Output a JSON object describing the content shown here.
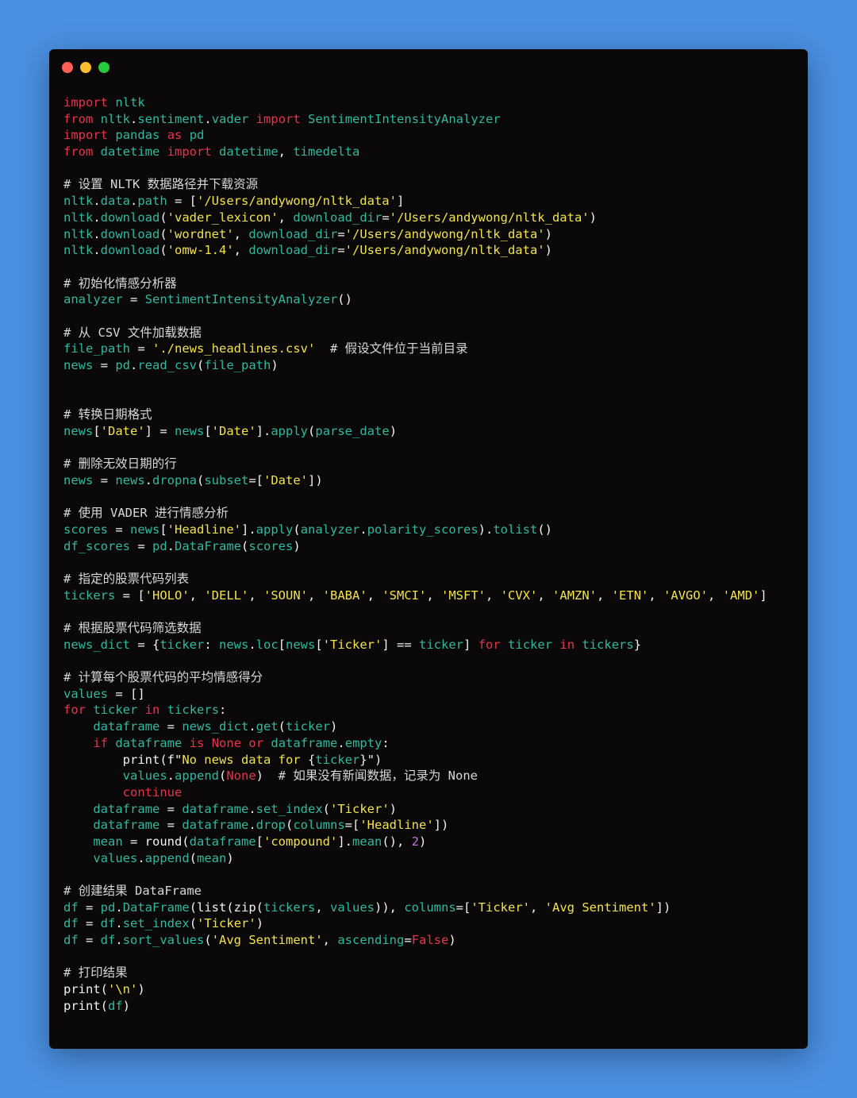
{
  "window": {
    "buttons": [
      "close",
      "minimize",
      "maximize"
    ]
  },
  "colors": {
    "background": "#4a90e2",
    "editor_bg": "#0a0808",
    "keyword": "#e8344a",
    "identifier": "#2fb99f",
    "string": "#f2e34c",
    "comment": "#d8d8d8",
    "number": "#c678dd",
    "plain": "#f2f2f2"
  },
  "code_lines": [
    [
      [
        "kw",
        "import"
      ],
      [
        "pl",
        " "
      ],
      [
        "id",
        "nltk"
      ]
    ],
    [
      [
        "kw",
        "from"
      ],
      [
        "pl",
        " "
      ],
      [
        "id",
        "nltk"
      ],
      [
        "pl",
        "."
      ],
      [
        "id",
        "sentiment"
      ],
      [
        "pl",
        "."
      ],
      [
        "id",
        "vader"
      ],
      [
        "pl",
        " "
      ],
      [
        "kw",
        "import"
      ],
      [
        "pl",
        " "
      ],
      [
        "id",
        "SentimentIntensityAnalyzer"
      ]
    ],
    [
      [
        "kw",
        "import"
      ],
      [
        "pl",
        " "
      ],
      [
        "id",
        "pandas"
      ],
      [
        "pl",
        " "
      ],
      [
        "kw",
        "as"
      ],
      [
        "pl",
        " "
      ],
      [
        "id",
        "pd"
      ]
    ],
    [
      [
        "kw",
        "from"
      ],
      [
        "pl",
        " "
      ],
      [
        "id",
        "datetime"
      ],
      [
        "pl",
        " "
      ],
      [
        "kw",
        "import"
      ],
      [
        "pl",
        " "
      ],
      [
        "id",
        "datetime"
      ],
      [
        "pl",
        ", "
      ],
      [
        "id",
        "timedelta"
      ]
    ],
    [],
    [
      [
        "cm",
        "# 设置 NLTK 数据路径并下载资源"
      ]
    ],
    [
      [
        "id",
        "nltk"
      ],
      [
        "pl",
        "."
      ],
      [
        "id",
        "data"
      ],
      [
        "pl",
        "."
      ],
      [
        "id",
        "path"
      ],
      [
        "pl",
        " = ["
      ],
      [
        "str",
        "'/Users/andywong/nltk_data'"
      ],
      [
        "pl",
        "]"
      ]
    ],
    [
      [
        "id",
        "nltk"
      ],
      [
        "pl",
        "."
      ],
      [
        "id",
        "download"
      ],
      [
        "pl",
        "("
      ],
      [
        "str",
        "'vader_lexicon'"
      ],
      [
        "pl",
        ", "
      ],
      [
        "id",
        "download_dir"
      ],
      [
        "pl",
        "="
      ],
      [
        "str",
        "'/Users/andywong/nltk_data'"
      ],
      [
        "pl",
        ")"
      ]
    ],
    [
      [
        "id",
        "nltk"
      ],
      [
        "pl",
        "."
      ],
      [
        "id",
        "download"
      ],
      [
        "pl",
        "("
      ],
      [
        "str",
        "'wordnet'"
      ],
      [
        "pl",
        ", "
      ],
      [
        "id",
        "download_dir"
      ],
      [
        "pl",
        "="
      ],
      [
        "str",
        "'/Users/andywong/nltk_data'"
      ],
      [
        "pl",
        ")"
      ]
    ],
    [
      [
        "id",
        "nltk"
      ],
      [
        "pl",
        "."
      ],
      [
        "id",
        "download"
      ],
      [
        "pl",
        "("
      ],
      [
        "str",
        "'omw-1.4'"
      ],
      [
        "pl",
        ", "
      ],
      [
        "id",
        "download_dir"
      ],
      [
        "pl",
        "="
      ],
      [
        "str",
        "'/Users/andywong/nltk_data'"
      ],
      [
        "pl",
        ")"
      ]
    ],
    [],
    [
      [
        "cm",
        "# 初始化情感分析器"
      ]
    ],
    [
      [
        "id",
        "analyzer"
      ],
      [
        "pl",
        " = "
      ],
      [
        "id",
        "SentimentIntensityAnalyzer"
      ],
      [
        "pl",
        "()"
      ]
    ],
    [],
    [
      [
        "cm",
        "# 从 CSV 文件加载数据"
      ]
    ],
    [
      [
        "id",
        "file_path"
      ],
      [
        "pl",
        " = "
      ],
      [
        "str",
        "'./news_headlines.csv'"
      ],
      [
        "pl",
        "  "
      ],
      [
        "cm",
        "# 假设文件位于当前目录"
      ]
    ],
    [
      [
        "id",
        "news"
      ],
      [
        "pl",
        " = "
      ],
      [
        "id",
        "pd"
      ],
      [
        "pl",
        "."
      ],
      [
        "id",
        "read_csv"
      ],
      [
        "pl",
        "("
      ],
      [
        "id",
        "file_path"
      ],
      [
        "pl",
        ")"
      ]
    ],
    [],
    [],
    [
      [
        "cm",
        "# 转换日期格式"
      ]
    ],
    [
      [
        "id",
        "news"
      ],
      [
        "pl",
        "["
      ],
      [
        "str",
        "'Date'"
      ],
      [
        "pl",
        "] = "
      ],
      [
        "id",
        "news"
      ],
      [
        "pl",
        "["
      ],
      [
        "str",
        "'Date'"
      ],
      [
        "pl",
        "]."
      ],
      [
        "id",
        "apply"
      ],
      [
        "pl",
        "("
      ],
      [
        "id",
        "parse_date"
      ],
      [
        "pl",
        ")"
      ]
    ],
    [],
    [
      [
        "cm",
        "# 删除无效日期的行"
      ]
    ],
    [
      [
        "id",
        "news"
      ],
      [
        "pl",
        " = "
      ],
      [
        "id",
        "news"
      ],
      [
        "pl",
        "."
      ],
      [
        "id",
        "dropna"
      ],
      [
        "pl",
        "("
      ],
      [
        "id",
        "subset"
      ],
      [
        "pl",
        "=["
      ],
      [
        "str",
        "'Date'"
      ],
      [
        "pl",
        "])"
      ]
    ],
    [],
    [
      [
        "cm",
        "# 使用 VADER 进行情感分析"
      ]
    ],
    [
      [
        "id",
        "scores"
      ],
      [
        "pl",
        " = "
      ],
      [
        "id",
        "news"
      ],
      [
        "pl",
        "["
      ],
      [
        "str",
        "'Headline'"
      ],
      [
        "pl",
        "]."
      ],
      [
        "id",
        "apply"
      ],
      [
        "pl",
        "("
      ],
      [
        "id",
        "analyzer"
      ],
      [
        "pl",
        "."
      ],
      [
        "id",
        "polarity_scores"
      ],
      [
        "pl",
        ")."
      ],
      [
        "id",
        "tolist"
      ],
      [
        "pl",
        "()"
      ]
    ],
    [
      [
        "id",
        "df_scores"
      ],
      [
        "pl",
        " = "
      ],
      [
        "id",
        "pd"
      ],
      [
        "pl",
        "."
      ],
      [
        "id",
        "DataFrame"
      ],
      [
        "pl",
        "("
      ],
      [
        "id",
        "scores"
      ],
      [
        "pl",
        ")"
      ]
    ],
    [],
    [
      [
        "cm",
        "# 指定的股票代码列表"
      ]
    ],
    [
      [
        "id",
        "tickers"
      ],
      [
        "pl",
        " = ["
      ],
      [
        "str",
        "'HOLO'"
      ],
      [
        "pl",
        ", "
      ],
      [
        "str",
        "'DELL'"
      ],
      [
        "pl",
        ", "
      ],
      [
        "str",
        "'SOUN'"
      ],
      [
        "pl",
        ", "
      ],
      [
        "str",
        "'BABA'"
      ],
      [
        "pl",
        ", "
      ],
      [
        "str",
        "'SMCI'"
      ],
      [
        "pl",
        ", "
      ],
      [
        "str",
        "'MSFT'"
      ],
      [
        "pl",
        ", "
      ],
      [
        "str",
        "'CVX'"
      ],
      [
        "pl",
        ", "
      ],
      [
        "str",
        "'AMZN'"
      ],
      [
        "pl",
        ", "
      ],
      [
        "str",
        "'ETN'"
      ],
      [
        "pl",
        ", "
      ],
      [
        "str",
        "'AVGO'"
      ],
      [
        "pl",
        ", "
      ],
      [
        "str",
        "'AMD'"
      ],
      [
        "pl",
        "]"
      ]
    ],
    [],
    [
      [
        "cm",
        "# 根据股票代码筛选数据"
      ]
    ],
    [
      [
        "id",
        "news_dict"
      ],
      [
        "pl",
        " = {"
      ],
      [
        "id",
        "ticker"
      ],
      [
        "pl",
        ": "
      ],
      [
        "id",
        "news"
      ],
      [
        "pl",
        "."
      ],
      [
        "id",
        "loc"
      ],
      [
        "pl",
        "["
      ],
      [
        "id",
        "news"
      ],
      [
        "pl",
        "["
      ],
      [
        "str",
        "'Ticker'"
      ],
      [
        "pl",
        "] == "
      ],
      [
        "id",
        "ticker"
      ],
      [
        "pl",
        "] "
      ],
      [
        "kw",
        "for"
      ],
      [
        "pl",
        " "
      ],
      [
        "id",
        "ticker"
      ],
      [
        "pl",
        " "
      ],
      [
        "kw",
        "in"
      ],
      [
        "pl",
        " "
      ],
      [
        "id",
        "tickers"
      ],
      [
        "pl",
        "}"
      ]
    ],
    [],
    [
      [
        "cm",
        "# 计算每个股票代码的平均情感得分"
      ]
    ],
    [
      [
        "id",
        "values"
      ],
      [
        "pl",
        " = []"
      ]
    ],
    [
      [
        "kw",
        "for"
      ],
      [
        "pl",
        " "
      ],
      [
        "id",
        "ticker"
      ],
      [
        "pl",
        " "
      ],
      [
        "kw",
        "in"
      ],
      [
        "pl",
        " "
      ],
      [
        "id",
        "tickers"
      ],
      [
        "pl",
        ":"
      ]
    ],
    [
      [
        "pl",
        "    "
      ],
      [
        "id",
        "dataframe"
      ],
      [
        "pl",
        " = "
      ],
      [
        "id",
        "news_dict"
      ],
      [
        "pl",
        "."
      ],
      [
        "id",
        "get"
      ],
      [
        "pl",
        "("
      ],
      [
        "id",
        "ticker"
      ],
      [
        "pl",
        ")"
      ]
    ],
    [
      [
        "pl",
        "    "
      ],
      [
        "kw",
        "if"
      ],
      [
        "pl",
        " "
      ],
      [
        "id",
        "dataframe"
      ],
      [
        "pl",
        " "
      ],
      [
        "kw",
        "is"
      ],
      [
        "pl",
        " "
      ],
      [
        "kw",
        "None"
      ],
      [
        "pl",
        " "
      ],
      [
        "kw",
        "or"
      ],
      [
        "pl",
        " "
      ],
      [
        "id",
        "dataframe"
      ],
      [
        "pl",
        "."
      ],
      [
        "id",
        "empty"
      ],
      [
        "pl",
        ":"
      ]
    ],
    [
      [
        "pl",
        "        print(f\""
      ],
      [
        "str",
        "No news data for "
      ],
      [
        "pl",
        "{"
      ],
      [
        "id",
        "ticker"
      ],
      [
        "pl",
        "}\")"
      ]
    ],
    [
      [
        "pl",
        "        "
      ],
      [
        "id",
        "values"
      ],
      [
        "pl",
        "."
      ],
      [
        "id",
        "append"
      ],
      [
        "pl",
        "("
      ],
      [
        "kw",
        "None"
      ],
      [
        "pl",
        ")  "
      ],
      [
        "cm",
        "# 如果没有新闻数据，记录为 None"
      ]
    ],
    [
      [
        "pl",
        "        "
      ],
      [
        "kw",
        "continue"
      ]
    ],
    [
      [
        "pl",
        "    "
      ],
      [
        "id",
        "dataframe"
      ],
      [
        "pl",
        " = "
      ],
      [
        "id",
        "dataframe"
      ],
      [
        "pl",
        "."
      ],
      [
        "id",
        "set_index"
      ],
      [
        "pl",
        "("
      ],
      [
        "str",
        "'Ticker'"
      ],
      [
        "pl",
        ")"
      ]
    ],
    [
      [
        "pl",
        "    "
      ],
      [
        "id",
        "dataframe"
      ],
      [
        "pl",
        " = "
      ],
      [
        "id",
        "dataframe"
      ],
      [
        "pl",
        "."
      ],
      [
        "id",
        "drop"
      ],
      [
        "pl",
        "("
      ],
      [
        "id",
        "columns"
      ],
      [
        "pl",
        "=["
      ],
      [
        "str",
        "'Headline'"
      ],
      [
        "pl",
        "])"
      ]
    ],
    [
      [
        "pl",
        "    "
      ],
      [
        "id",
        "mean"
      ],
      [
        "pl",
        " = round("
      ],
      [
        "id",
        "dataframe"
      ],
      [
        "pl",
        "["
      ],
      [
        "str",
        "'compound'"
      ],
      [
        "pl",
        "]."
      ],
      [
        "id",
        "mean"
      ],
      [
        "pl",
        "(), "
      ],
      [
        "num",
        "2"
      ],
      [
        "pl",
        ")"
      ]
    ],
    [
      [
        "pl",
        "    "
      ],
      [
        "id",
        "values"
      ],
      [
        "pl",
        "."
      ],
      [
        "id",
        "append"
      ],
      [
        "pl",
        "("
      ],
      [
        "id",
        "mean"
      ],
      [
        "pl",
        ")"
      ]
    ],
    [],
    [
      [
        "cm",
        "# 创建结果 DataFrame"
      ]
    ],
    [
      [
        "id",
        "df"
      ],
      [
        "pl",
        " = "
      ],
      [
        "id",
        "pd"
      ],
      [
        "pl",
        "."
      ],
      [
        "id",
        "DataFrame"
      ],
      [
        "pl",
        "(list(zip("
      ],
      [
        "id",
        "tickers"
      ],
      [
        "pl",
        ", "
      ],
      [
        "id",
        "values"
      ],
      [
        "pl",
        ")), "
      ],
      [
        "id",
        "columns"
      ],
      [
        "pl",
        "=["
      ],
      [
        "str",
        "'Ticker'"
      ],
      [
        "pl",
        ", "
      ],
      [
        "str",
        "'Avg Sentiment'"
      ],
      [
        "pl",
        "])"
      ]
    ],
    [
      [
        "id",
        "df"
      ],
      [
        "pl",
        " = "
      ],
      [
        "id",
        "df"
      ],
      [
        "pl",
        "."
      ],
      [
        "id",
        "set_index"
      ],
      [
        "pl",
        "("
      ],
      [
        "str",
        "'Ticker'"
      ],
      [
        "pl",
        ")"
      ]
    ],
    [
      [
        "id",
        "df"
      ],
      [
        "pl",
        " = "
      ],
      [
        "id",
        "df"
      ],
      [
        "pl",
        "."
      ],
      [
        "id",
        "sort_values"
      ],
      [
        "pl",
        "("
      ],
      [
        "str",
        "'Avg Sentiment'"
      ],
      [
        "pl",
        ", "
      ],
      [
        "id",
        "ascending"
      ],
      [
        "pl",
        "="
      ],
      [
        "kw",
        "False"
      ],
      [
        "pl",
        ")"
      ]
    ],
    [],
    [
      [
        "cm",
        "# 打印结果"
      ]
    ],
    [
      [
        "pl",
        "print("
      ],
      [
        "str",
        "'\\n'"
      ],
      [
        "pl",
        ")"
      ]
    ],
    [
      [
        "pl",
        "print("
      ],
      [
        "id",
        "df"
      ],
      [
        "pl",
        ")"
      ]
    ]
  ]
}
